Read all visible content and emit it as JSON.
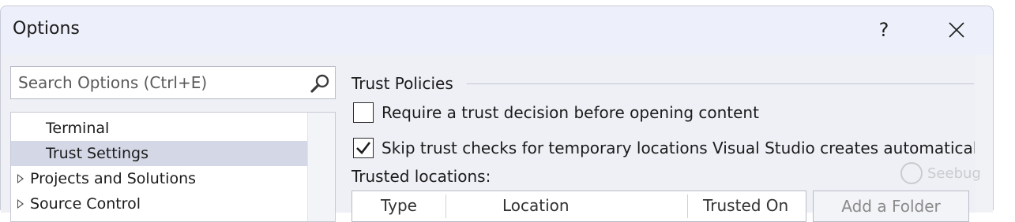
{
  "window": {
    "title": "Options"
  },
  "titlebar": {
    "help_label": "?",
    "close_icon": "close-icon"
  },
  "search": {
    "placeholder": "Search Options (Ctrl+E)",
    "value": "",
    "icon": "search-icon"
  },
  "tree": {
    "items": [
      {
        "label": "Terminal",
        "selected": false,
        "expandable": false
      },
      {
        "label": "Trust Settings",
        "selected": true,
        "expandable": false
      },
      {
        "label": "Projects and Solutions",
        "selected": false,
        "expandable": true
      },
      {
        "label": "Source Control",
        "selected": false,
        "expandable": true
      }
    ]
  },
  "trust": {
    "section_title": "Trust Policies",
    "options": [
      {
        "label": "Require a trust decision before opening content",
        "checked": false
      },
      {
        "label": "Skip trust checks for temporary locations Visual Studio creates automatically",
        "checked": true
      }
    ],
    "trusted_locations_label": "Trusted locations:",
    "table_headers": [
      "Type",
      "Location",
      "Trusted On"
    ],
    "add_folder_label": "Add a Folder"
  },
  "watermark": {
    "text": "Seebug"
  }
}
